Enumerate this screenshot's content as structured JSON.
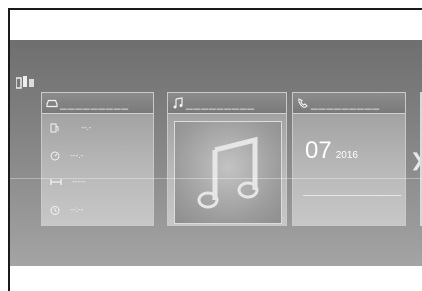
{
  "vehicle_panel": {
    "dashes": "_________",
    "fuel_value": "--.-",
    "speed_value": "---.-",
    "distance_value": "-----",
    "time_value": "--:--"
  },
  "audio_panel": {
    "dashes": "_________"
  },
  "phone_panel": {
    "dashes": "_________",
    "day": "07",
    "year": "2016"
  },
  "nav": {
    "next_glyph": "❯"
  }
}
